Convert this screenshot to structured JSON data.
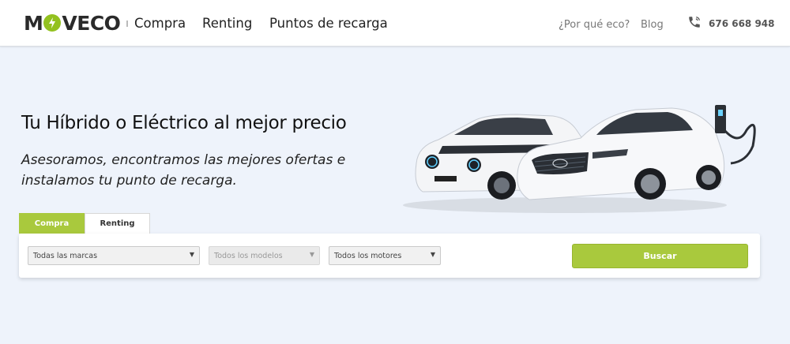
{
  "brand": {
    "logo_text_left": "M",
    "logo_text_right": "VECO",
    "accent_color": "#a9c93d"
  },
  "nav": {
    "items": [
      {
        "label": "Compra"
      },
      {
        "label": "Renting"
      },
      {
        "label": "Puntos de recarga"
      }
    ],
    "secondary": [
      {
        "label": "¿Por qué eco?"
      },
      {
        "label": "Blog"
      }
    ],
    "phone": {
      "number": "676 668 948",
      "icon": "phone-icon"
    }
  },
  "hero": {
    "title": "Tu Híbrido o Eléctrico al mejor precio",
    "subtitle_line1": "Asesoramos, encontramos las mejores ofertas e",
    "subtitle_line2": "instalamos tu punto de recarga."
  },
  "search": {
    "tabs": [
      {
        "label": "Compra",
        "active": true
      },
      {
        "label": "Renting",
        "active": false
      }
    ],
    "brand_select": {
      "value": "Todas las marcas"
    },
    "model_select": {
      "value": "Todos los modelos",
      "disabled": true
    },
    "engine_select": {
      "value": "Todos los motores"
    },
    "submit_label": "Buscar"
  }
}
